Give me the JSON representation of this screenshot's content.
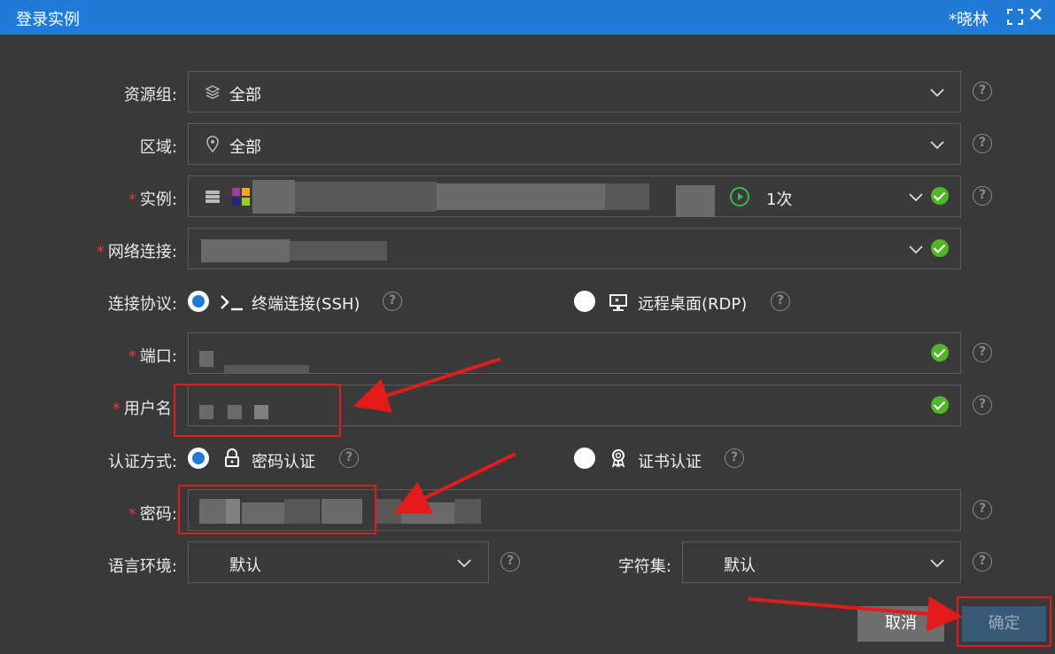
{
  "window": {
    "title": "登录实例",
    "user": "*晓林",
    "fullscreen_icon": "fullscreen-icon",
    "close_icon": "close-icon"
  },
  "form": {
    "resource_group": {
      "label": "资源组:",
      "value": "全部",
      "icon": "layers-icon"
    },
    "region": {
      "label": "区域:",
      "value": "全部",
      "icon": "location-pin-icon"
    },
    "instance": {
      "required_mark": "*",
      "label": "实例:",
      "count": "1次",
      "icons": [
        "server-icon",
        "os-logo-icon",
        "play-circle-icon"
      ]
    },
    "network": {
      "required_mark": "*",
      "label": "网络连接:"
    },
    "protocol": {
      "label": "连接协议:",
      "options": [
        {
          "label": "终端连接(SSH)",
          "icon": "terminal-icon",
          "selected": true
        },
        {
          "label": "远程桌面(RDP)",
          "icon": "monitor-icon",
          "selected": false
        }
      ]
    },
    "port": {
      "required_mark": "*",
      "label": "端口:"
    },
    "username": {
      "required_mark": "*",
      "label": "用户名:"
    },
    "auth": {
      "label": "认证方式:",
      "options": [
        {
          "label": "密码认证",
          "icon": "lock-icon",
          "selected": true
        },
        {
          "label": "证书认证",
          "icon": "certificate-icon",
          "selected": false
        }
      ]
    },
    "password": {
      "required_mark": "*",
      "label": "密码:"
    },
    "locale": {
      "label": "语言环境:",
      "value": "默认"
    },
    "charset": {
      "label": "字符集:",
      "value": "默认"
    }
  },
  "buttons": {
    "cancel": "取消",
    "confirm": "确定"
  },
  "colors": {
    "titlebar": "#1f7bd6",
    "background": "#393939",
    "success": "#52b52a",
    "required": "#e03a3a",
    "annotation": "#e21b1b"
  }
}
